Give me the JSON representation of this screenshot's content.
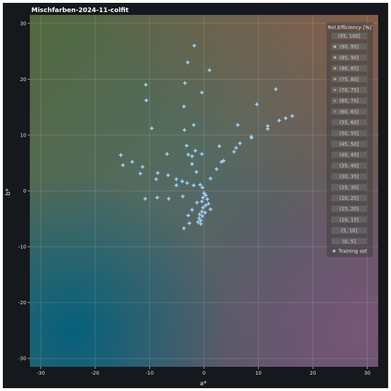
{
  "chart_data": {
    "type": "scatter",
    "title": "Mischfarben-2024-11-colfit",
    "xlabel": "a*",
    "ylabel": "b*",
    "xlim": [
      -32,
      32
    ],
    "ylim": [
      -31.5,
      31.5
    ],
    "xticks": [
      -30,
      -20,
      -10,
      0,
      10,
      20,
      30
    ],
    "yticks": [
      -30,
      -20,
      -10,
      0,
      10,
      20,
      30
    ],
    "grid": true,
    "legend_position": "top-right",
    "legend": {
      "title": "Rel.Efficiency [%]",
      "entries": [
        {
          "label": "(95, 100]",
          "marker": ""
        },
        {
          "label": "(90, 95]",
          "marker": "#c9c27a"
        },
        {
          "label": "(85, 90]",
          "marker": "#c3b57a"
        },
        {
          "label": "(80, 85]",
          "marker": "#c0a672"
        },
        {
          "label": "(75, 80]",
          "marker": "#bd9a6c"
        },
        {
          "label": "(70, 75]",
          "marker": "#b99168"
        },
        {
          "label": "(65, 70]",
          "marker": "#b48766"
        },
        {
          "label": "(60, 65]",
          "marker": "#ae7e64"
        },
        {
          "label": "(55, 60]",
          "marker": ""
        },
        {
          "label": "(50, 55]",
          "marker": ""
        },
        {
          "label": "(45, 50]",
          "marker": ""
        },
        {
          "label": "(40, 45]",
          "marker": ""
        },
        {
          "label": "(35, 40]",
          "marker": ""
        },
        {
          "label": "(30, 35]",
          "marker": ""
        },
        {
          "label": "(25, 30]",
          "marker": ""
        },
        {
          "label": "(20, 25]",
          "marker": ""
        },
        {
          "label": "(15, 20]",
          "marker": ""
        },
        {
          "label": "(10, 15]",
          "marker": ""
        },
        {
          "label": "(5, 10]",
          "marker": ""
        },
        {
          "label": "(0, 5]",
          "marker": ""
        }
      ]
    },
    "series": [
      {
        "name": "Training set",
        "marker": "plus",
        "color": "#9fd3ff",
        "points": [
          [
            -1.8,
            26.0
          ],
          [
            -3.0,
            23.0
          ],
          [
            1.0,
            21.6
          ],
          [
            -3.5,
            19.3
          ],
          [
            -10.7,
            19.0
          ],
          [
            -0.4,
            17.6
          ],
          [
            -10.6,
            16.2
          ],
          [
            13.2,
            18.2
          ],
          [
            9.7,
            15.5
          ],
          [
            -3.7,
            15.1
          ],
          [
            16.2,
            13.4
          ],
          [
            15.0,
            13.0
          ],
          [
            13.8,
            12.6
          ],
          [
            11.7,
            11.6
          ],
          [
            11.7,
            11.1
          ],
          [
            6.2,
            11.8
          ],
          [
            -1.9,
            11.8
          ],
          [
            -9.6,
            11.2
          ],
          [
            -3.6,
            10.9
          ],
          [
            8.7,
            9.7
          ],
          [
            8.7,
            9.5
          ],
          [
            6.6,
            8.5
          ],
          [
            5.9,
            7.7
          ],
          [
            5.5,
            7.0
          ],
          [
            2.8,
            8.0
          ],
          [
            -3.2,
            8.1
          ],
          [
            -1.6,
            7.2
          ],
          [
            -15.3,
            6.4
          ],
          [
            -6.8,
            6.6
          ],
          [
            -2.2,
            6.2
          ],
          [
            -0.4,
            6.6
          ],
          [
            -2.9,
            6.5
          ],
          [
            3.6,
            5.4
          ],
          [
            3.2,
            5.2
          ],
          [
            -13.2,
            5.2
          ],
          [
            -2.2,
            4.8
          ],
          [
            -14.9,
            4.6
          ],
          [
            2.3,
            3.9
          ],
          [
            -11.3,
            4.3
          ],
          [
            -1.4,
            3.4
          ],
          [
            -8.5,
            3.2
          ],
          [
            -11.7,
            3.1
          ],
          [
            -6.6,
            2.8
          ],
          [
            1.2,
            2.2
          ],
          [
            -5.1,
            2.1
          ],
          [
            -8.8,
            2.1
          ],
          [
            -4.0,
            1.7
          ],
          [
            -3.1,
            1.4
          ],
          [
            -5.1,
            1.0
          ],
          [
            -1.9,
            1.0
          ],
          [
            -0.7,
            1.1
          ],
          [
            -0.3,
            0.6
          ],
          [
            -3.9,
            -1.0
          ],
          [
            -8.6,
            -1.2
          ],
          [
            -6.5,
            -1.4
          ],
          [
            -10.8,
            -1.4
          ],
          [
            0.0,
            -0.4
          ],
          [
            0.3,
            -0.8
          ],
          [
            -0.2,
            -1.2
          ],
          [
            0.6,
            -1.5
          ],
          [
            -0.4,
            -1.9
          ],
          [
            0.8,
            -2.3
          ],
          [
            -1.3,
            -2.1
          ],
          [
            0.3,
            -2.6
          ],
          [
            -0.2,
            -3.0
          ],
          [
            1.2,
            -3.3
          ],
          [
            -2.2,
            -3.4
          ],
          [
            -0.4,
            -3.7
          ],
          [
            0.2,
            -3.9
          ],
          [
            -0.8,
            -4.2
          ],
          [
            -0.3,
            -4.5
          ],
          [
            -0.9,
            -4.9
          ],
          [
            -2.9,
            -4.4
          ],
          [
            -0.6,
            -5.3
          ],
          [
            -1.1,
            -5.6
          ],
          [
            -0.6,
            -5.9
          ],
          [
            -2.7,
            -5.8
          ],
          [
            -3.7,
            -6.7
          ]
        ]
      }
    ]
  }
}
